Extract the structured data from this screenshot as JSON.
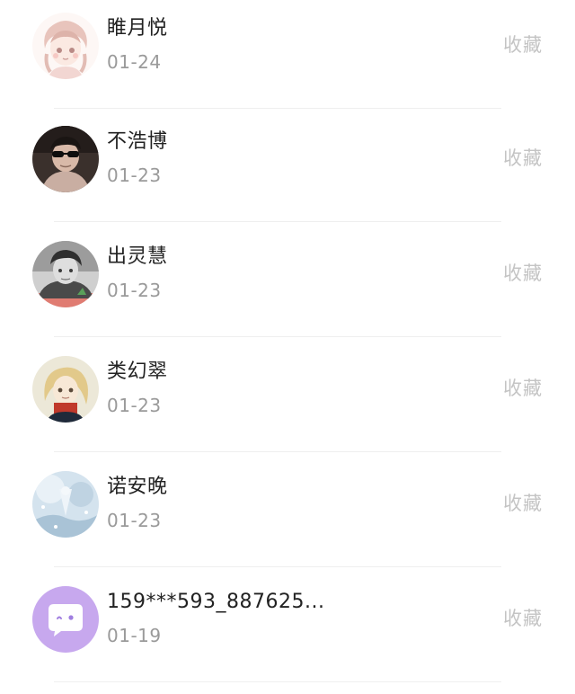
{
  "contacts": [
    {
      "name": "睢月悦",
      "date": "01-24",
      "action": "收藏",
      "avatar": "anime-girl-avatar"
    },
    {
      "name": "不浩博",
      "date": "01-23",
      "action": "收藏",
      "avatar": "boy-sunglasses-avatar"
    },
    {
      "name": "出灵慧",
      "date": "01-23",
      "action": "收藏",
      "avatar": "boy-grayscale-avatar"
    },
    {
      "name": "类幻翠",
      "date": "01-23",
      "action": "收藏",
      "avatar": "blonde-girl-avatar"
    },
    {
      "name": "诺安晚",
      "date": "01-23",
      "action": "收藏",
      "avatar": "winter-scene-avatar"
    },
    {
      "name": "159***593_887625...",
      "date": "01-19",
      "action": "收藏",
      "avatar": "default-chat-bubble-avatar"
    }
  ]
}
